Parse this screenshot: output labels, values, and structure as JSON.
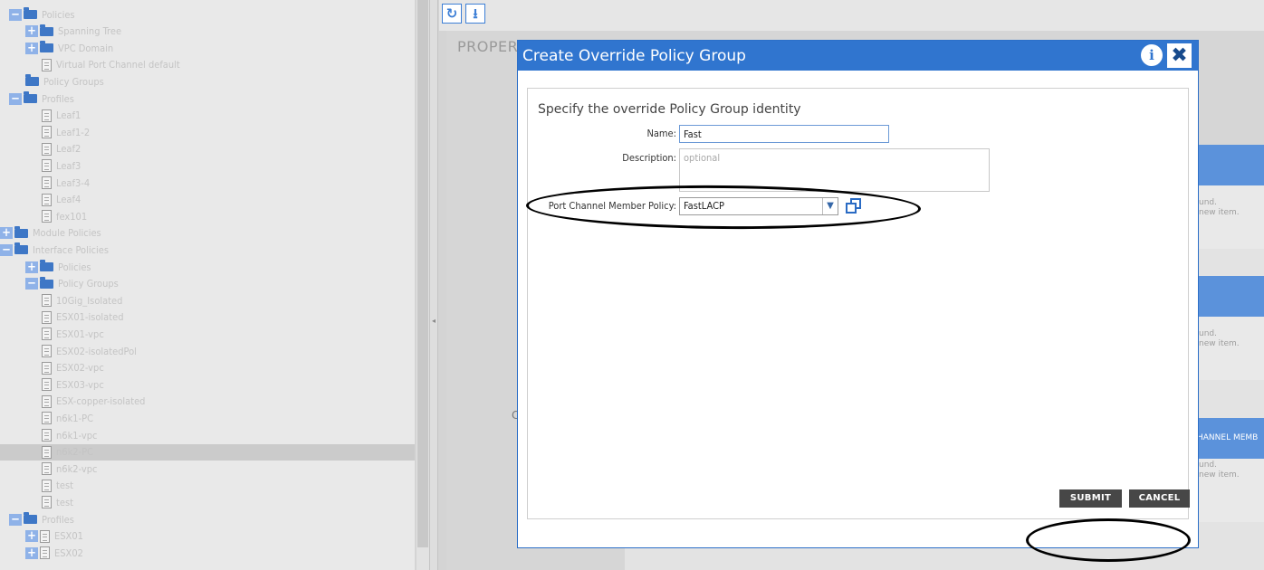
{
  "tree": {
    "nodes": [
      {
        "label": "Policies",
        "indent": 0,
        "icon": "folder",
        "expander": "minus"
      },
      {
        "label": "Spanning Tree",
        "indent": 1,
        "icon": "folder",
        "expander": "plus"
      },
      {
        "label": "VPC Domain",
        "indent": 1,
        "icon": "folder",
        "expander": "plus"
      },
      {
        "label": "Virtual Port Channel default",
        "indent": 2,
        "icon": "document",
        "expander": ""
      },
      {
        "label": "Policy Groups",
        "indent": 1,
        "icon": "folder",
        "expander": ""
      },
      {
        "label": "Profiles",
        "indent": 0,
        "icon": "folder",
        "expander": "minus"
      },
      {
        "label": "Leaf1",
        "indent": 2,
        "icon": "document",
        "expander": ""
      },
      {
        "label": "Leaf1-2",
        "indent": 2,
        "icon": "document",
        "expander": ""
      },
      {
        "label": "Leaf2",
        "indent": 2,
        "icon": "document",
        "expander": ""
      },
      {
        "label": "Leaf3",
        "indent": 2,
        "icon": "document",
        "expander": ""
      },
      {
        "label": "Leaf3-4",
        "indent": 2,
        "icon": "document",
        "expander": ""
      },
      {
        "label": "Leaf4",
        "indent": 2,
        "icon": "document",
        "expander": ""
      },
      {
        "label": "fex101",
        "indent": 2,
        "icon": "document",
        "expander": ""
      },
      {
        "label": "Module Policies",
        "indent": -1,
        "icon": "folder",
        "expander": "plus"
      },
      {
        "label": "Interface Policies",
        "indent": -1,
        "icon": "folder",
        "expander": "minus"
      },
      {
        "label": "Policies",
        "indent": 1,
        "icon": "folder",
        "expander": "plus"
      },
      {
        "label": "Policy Groups",
        "indent": 1,
        "icon": "folder",
        "expander": "minus"
      },
      {
        "label": "10Gig_Isolated",
        "indent": 2,
        "icon": "document",
        "expander": ""
      },
      {
        "label": "ESX01-isolated",
        "indent": 2,
        "icon": "document",
        "expander": ""
      },
      {
        "label": "ESX01-vpc",
        "indent": 2,
        "icon": "document",
        "expander": ""
      },
      {
        "label": "ESX02-isolatedPol",
        "indent": 2,
        "icon": "document",
        "expander": ""
      },
      {
        "label": "ESX02-vpc",
        "indent": 2,
        "icon": "document",
        "expander": ""
      },
      {
        "label": "ESX03-vpc",
        "indent": 2,
        "icon": "document",
        "expander": ""
      },
      {
        "label": "ESX-copper-isolated",
        "indent": 2,
        "icon": "document",
        "expander": ""
      },
      {
        "label": "n6k1-PC",
        "indent": 2,
        "icon": "document",
        "expander": ""
      },
      {
        "label": "n6k1-vpc",
        "indent": 2,
        "icon": "document",
        "expander": ""
      },
      {
        "label": "n6k2-PC",
        "indent": 2,
        "icon": "document",
        "expander": "",
        "selected": true
      },
      {
        "label": "n6k2-vpc",
        "indent": 2,
        "icon": "document",
        "expander": ""
      },
      {
        "label": "test",
        "indent": 2,
        "icon": "document",
        "expander": ""
      },
      {
        "label": "test",
        "indent": 2,
        "icon": "document",
        "expander": ""
      },
      {
        "label": "Profiles",
        "indent": 0,
        "icon": "folder",
        "expander": "minus"
      },
      {
        "label": "ESX01",
        "indent": 1,
        "icon": "document",
        "expander": "plus"
      },
      {
        "label": "ESX02",
        "indent": 1,
        "icon": "document",
        "expander": "plus"
      }
    ]
  },
  "toolbar": {
    "refresh_icon": "refresh-icon",
    "download_icon": "download-icon"
  },
  "background": {
    "properties_title": "PROPER",
    "stray_letter": "C",
    "right_band_label": "HANNEL MEMB",
    "right_notes": [
      {
        "line1": "und.",
        "line2": "new item."
      },
      {
        "line1": "und.",
        "line2": "new item."
      },
      {
        "line1": "und.",
        "line2": "new item."
      }
    ]
  },
  "modal": {
    "title": "Create Override Policy Group",
    "info_label": "i",
    "close_label": "✖",
    "heading": "Specify the override Policy Group identity",
    "fields": {
      "name": {
        "label": "Name:",
        "value": "Fast"
      },
      "description": {
        "label": "Description:",
        "placeholder": "optional",
        "value": ""
      },
      "port_channel_member_policy": {
        "label": "Port Channel Member Policy:",
        "value": "FastLACP"
      }
    },
    "buttons": {
      "submit": "SUBMIT",
      "cancel": "CANCEL"
    }
  },
  "colors": {
    "modal_header": "#3075cf",
    "button_dark": "#474747",
    "tree_folder": "#3e77c6",
    "tree_text": "#c4c4c4"
  }
}
